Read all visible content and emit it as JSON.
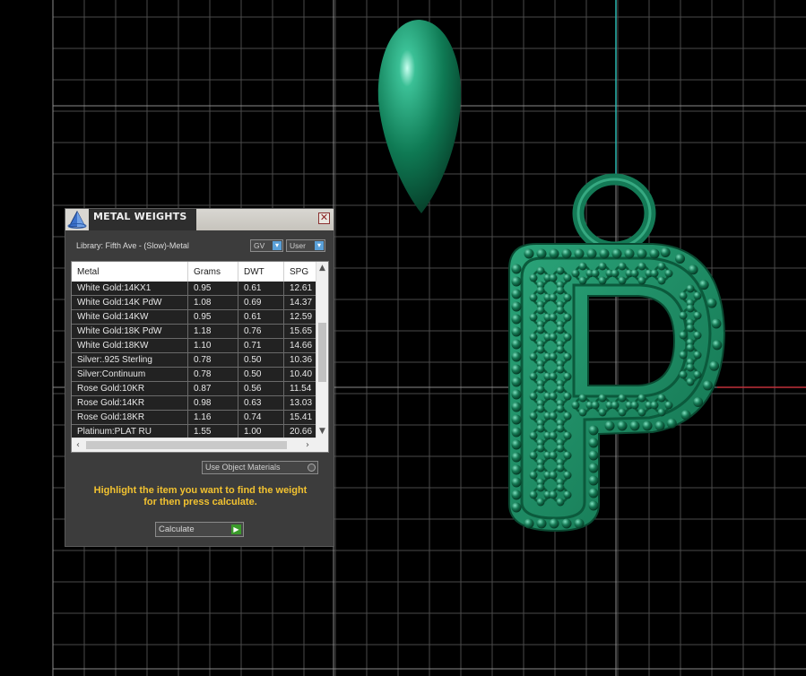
{
  "panel": {
    "title": "METAL WEIGHTS",
    "close_label": "✕",
    "library_label": "Library: Fifth Ave - (Slow)-Metal",
    "gv_select": "GV",
    "user_select": "User",
    "table": {
      "columns": [
        "Metal",
        "Grams",
        "DWT",
        "SPG"
      ],
      "rows": [
        [
          "White Gold:14KX1",
          "0.95",
          "0.61",
          "12.61"
        ],
        [
          "White Gold:14K PdW",
          "1.08",
          "0.69",
          "14.37"
        ],
        [
          "White Gold:14KW",
          "0.95",
          "0.61",
          "12.59"
        ],
        [
          "White Gold:18K PdW",
          "1.18",
          "0.76",
          "15.65"
        ],
        [
          "White Gold:18KW",
          "1.10",
          "0.71",
          "14.66"
        ],
        [
          "Silver:.925 Sterling",
          "0.78",
          "0.50",
          "10.36"
        ],
        [
          "Silver:Continuum",
          "0.78",
          "0.50",
          "10.40"
        ],
        [
          "Rose Gold:10KR",
          "0.87",
          "0.56",
          "11.54"
        ],
        [
          "Rose Gold:14KR",
          "0.98",
          "0.63",
          "13.03"
        ],
        [
          "Rose Gold:18KR",
          "1.16",
          "0.74",
          "15.41"
        ],
        [
          "Platinum:PLAT RU",
          "1.55",
          "1.00",
          "20.66"
        ]
      ]
    },
    "use_object_materials": "Use Object Materials",
    "hint_line1": "Highlight the item you want to find the weight",
    "hint_line2": "for then press calculate.",
    "calculate_label": "Calculate"
  },
  "colors": {
    "model_green": "#1e8a62",
    "hint_yellow": "#f2c230",
    "axis_cyan": "#2ab7b0",
    "axis_red": "#c0303a"
  },
  "icons": {
    "logo": "pyramid-logo-icon",
    "dropdown": "dropdown-arrow-icon",
    "play": "play-icon"
  }
}
